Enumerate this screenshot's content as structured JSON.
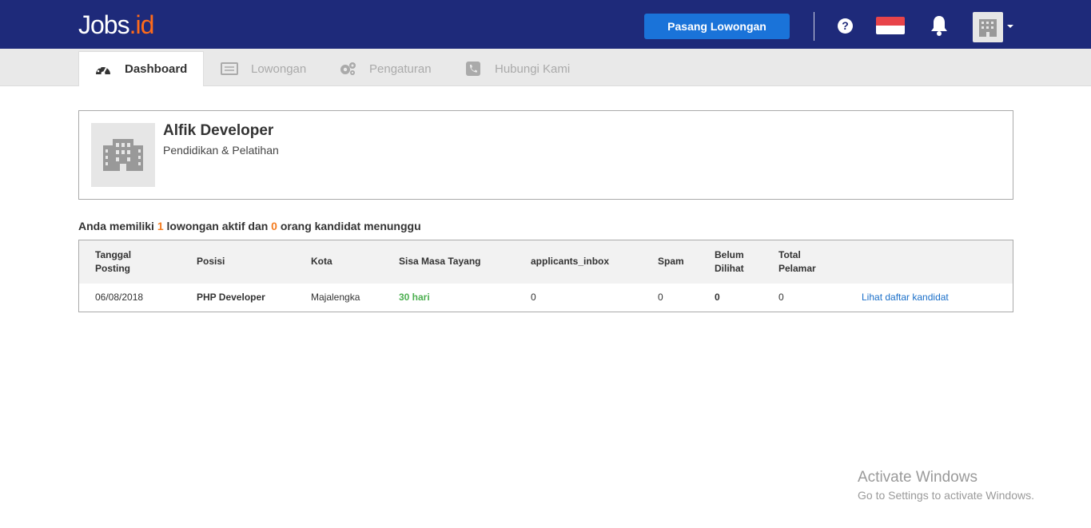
{
  "header": {
    "logo_main": "Jobs",
    "logo_dot": ".",
    "logo_suffix": "id",
    "post_button": "Pasang Lowongan",
    "help_glyph": "?"
  },
  "tabs": [
    {
      "label": "Dashboard",
      "icon": "dashboard-icon"
    },
    {
      "label": "Lowongan",
      "icon": "list-icon"
    },
    {
      "label": "Pengaturan",
      "icon": "gears-icon"
    },
    {
      "label": "Hubungi Kami",
      "icon": "phone-icon"
    }
  ],
  "company": {
    "name": "Alfik Developer",
    "industry": "Pendidikan & Pelatihan"
  },
  "summary": {
    "prefix": "Anda memiliki ",
    "active_count": "1",
    "middle": " lowongan aktif dan ",
    "waiting_count": "0",
    "suffix": " orang kandidat menunggu"
  },
  "table": {
    "headers": {
      "tanggal_1": "Tanggal",
      "tanggal_2": "Posting",
      "posisi": "Posisi",
      "kota": "Kota",
      "sisa": "Sisa Masa Tayang",
      "inbox": "applicants_inbox",
      "spam": "Spam",
      "belum_1": "Belum",
      "belum_2": "Dilihat",
      "total_1": "Total",
      "total_2": "Pelamar"
    },
    "row": {
      "tanggal": "06/08/2018",
      "posisi": "PHP Developer",
      "kota": "Majalengka",
      "sisa": "30 hari",
      "inbox": "0",
      "spam": "0",
      "belum": "0",
      "total": "0",
      "link": "Lihat daftar kandidat"
    }
  },
  "watermark": {
    "line1": "Activate Windows",
    "line2": "Go to Settings to activate Windows."
  },
  "colors": {
    "header_bg": "#1e2a7a",
    "button_bg": "#1a73d9",
    "accent_orange": "#f47c20",
    "status_green": "#4caf50",
    "link_blue": "#1a6fc9"
  }
}
